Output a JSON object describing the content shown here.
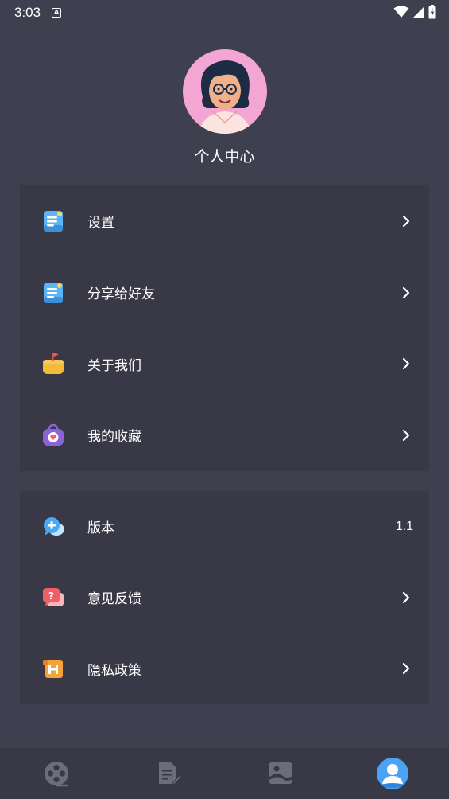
{
  "status_bar": {
    "time": "3:03",
    "notification_icon": "a-icon",
    "wifi_icon": "wifi-icon",
    "signal_icon": "signal-icon",
    "battery_icon": "battery-charging-icon"
  },
  "profile": {
    "avatar_icon": "cartoon-avatar",
    "title": "个人中心"
  },
  "menu_group_1": {
    "items": [
      {
        "label": "设置",
        "icon": "notebook-icon"
      },
      {
        "label": "分享给好友",
        "icon": "notebook-icon"
      },
      {
        "label": "关于我们",
        "icon": "flag-icon"
      },
      {
        "label": "我的收藏",
        "icon": "heart-bag-icon"
      }
    ]
  },
  "menu_group_2": {
    "items": [
      {
        "label": "版本",
        "value": "1.1",
        "icon": "chat-plus-icon"
      },
      {
        "label": "意见反馈",
        "icon": "question-chat-icon"
      },
      {
        "label": "隐私政策",
        "icon": "scroll-icon"
      }
    ]
  },
  "tabbar": {
    "tabs": [
      {
        "name": "film-reel-icon",
        "active": false
      },
      {
        "name": "document-edit-icon",
        "active": false
      },
      {
        "name": "image-icon",
        "active": false
      },
      {
        "name": "user-icon",
        "active": true
      }
    ]
  },
  "colors": {
    "background": "#3f404f",
    "card": "#383846",
    "active_tab": "#4aa3f5",
    "inactive_tab": "#6c6d7a",
    "avatar_bg": "#f3a6d4"
  }
}
